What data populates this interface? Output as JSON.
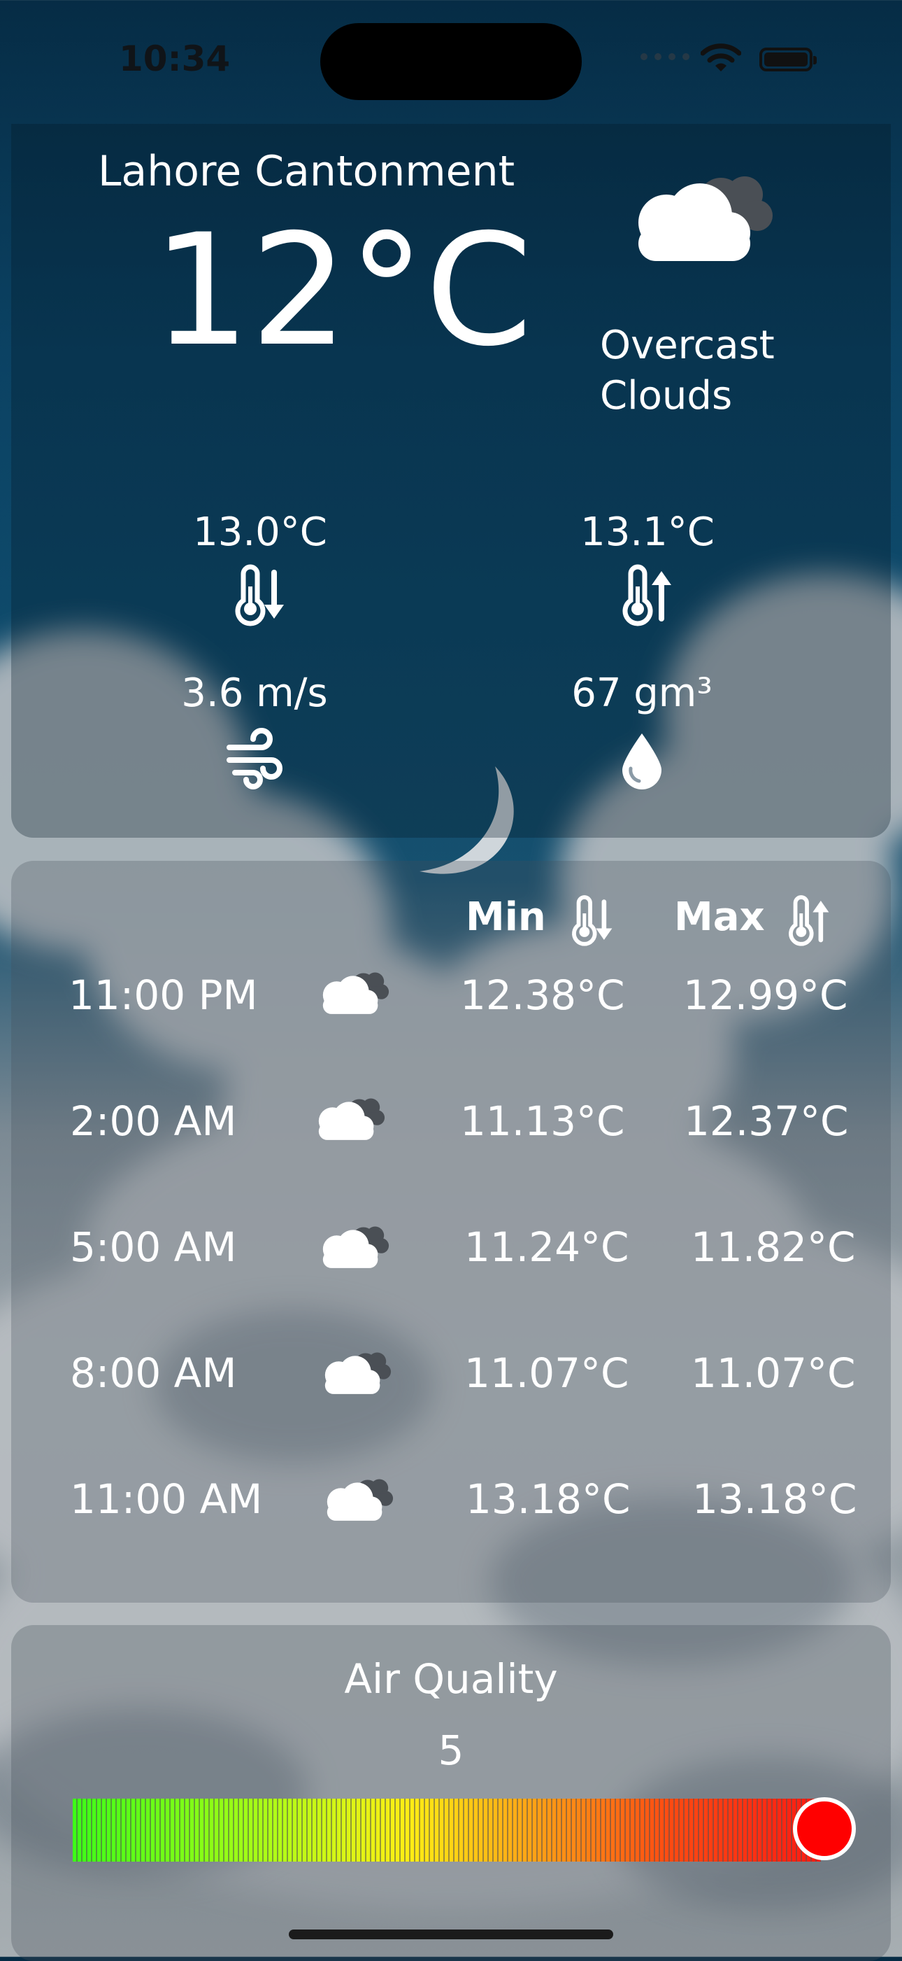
{
  "status_bar": {
    "time": "10:34"
  },
  "current": {
    "location": "Lahore Cantonment",
    "temperature": "12°C",
    "condition_line1": "Overcast",
    "condition_line2": "Clouds",
    "condition_icon": "overcast-clouds-icon",
    "min_temp": "13.0°C",
    "max_temp": "13.1°C",
    "wind": "3.6 m/s",
    "humidity": "67 gm³"
  },
  "forecast": {
    "min_header": "Min",
    "max_header": "Max",
    "rows": [
      {
        "time": "11:00 PM",
        "min": "12.38°C",
        "max": "12.99°C",
        "icon": "overcast-clouds-icon"
      },
      {
        "time": "2:00 AM",
        "min": "11.13°C",
        "max": "12.37°C",
        "icon": "overcast-clouds-icon"
      },
      {
        "time": "5:00 AM",
        "min": "11.24°C",
        "max": "11.82°C",
        "icon": "overcast-clouds-icon"
      },
      {
        "time": "8:00 AM",
        "min": "11.07°C",
        "max": "11.07°C",
        "icon": "overcast-clouds-icon"
      },
      {
        "time": "11:00 AM",
        "min": "13.18°C",
        "max": "13.18°C",
        "icon": "overcast-clouds-icon"
      }
    ]
  },
  "air_quality": {
    "title": "Air Quality",
    "value": "5",
    "slider_fraction": 1.0,
    "gradient_colors": [
      "#3cff18",
      "#ffee14",
      "#ffa015",
      "#ff1a12"
    ],
    "knob_color": "#ff0000"
  }
}
